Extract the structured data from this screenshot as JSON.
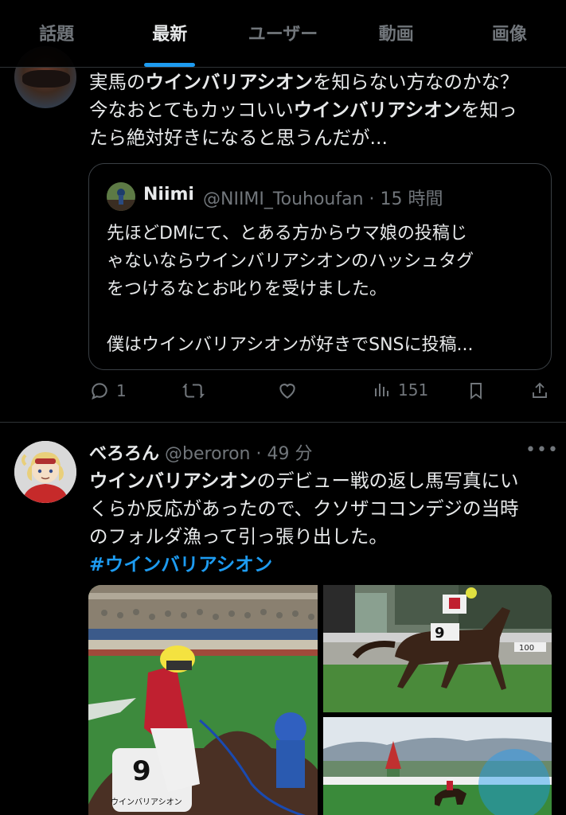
{
  "tabs": [
    {
      "label": "話題",
      "active": false
    },
    {
      "label": "最新",
      "active": true
    },
    {
      "label": "ユーザー",
      "active": false
    },
    {
      "label": "動画",
      "active": false
    },
    {
      "label": "画像",
      "active": false
    }
  ],
  "tweet1": {
    "line1_a": "実馬の",
    "line1_b": "ウインバリアシオン",
    "line1_c": "を知らない方なのかな？",
    "line2_a": "今なおとてもカッコいい",
    "line2_b": "ウインバリアシオン",
    "line2_c": "を知っ",
    "line3": "たら絶対好きになると思うんだが...",
    "quote": {
      "name": "Niimi",
      "handle_time": "@NIIMI_Touhoufan · 15 時間",
      "line1": "先ほどDMにて、とある方からウマ娘の投稿じ",
      "line2": "ゃないならウインバリアシオンのハッシュタグ",
      "line3": "をつけるなとお叱りを受けました。",
      "line4": "",
      "line5": "僕はウインバリアシオンが好きでSNSに投稿..."
    },
    "actions": {
      "reply_count": "1",
      "retweet_count": "",
      "like_count": "",
      "views_count": "151"
    }
  },
  "tweet2": {
    "name": "べろろん",
    "handle_time": "@beroron · 49 分",
    "more": "•••",
    "line1_a": "ウインバリアシオン",
    "line1_b": "のデビュー戦の返し馬写真にい",
    "line2": "くらか反応があったので、クソザココンデジの当時",
    "line3": "のフォルダ漁って引っ張り出した。",
    "hashtag": "#ウインバリアシオン",
    "photo_saddle_number": "9",
    "photo_saddle_name": "ウインバリアシオン",
    "photo2_saddle_number": "9",
    "photo2_board": "100"
  },
  "colors": {
    "accent": "#1d9bf0",
    "background": "#000000",
    "text": "#e7e9ea",
    "muted": "#71767b"
  }
}
